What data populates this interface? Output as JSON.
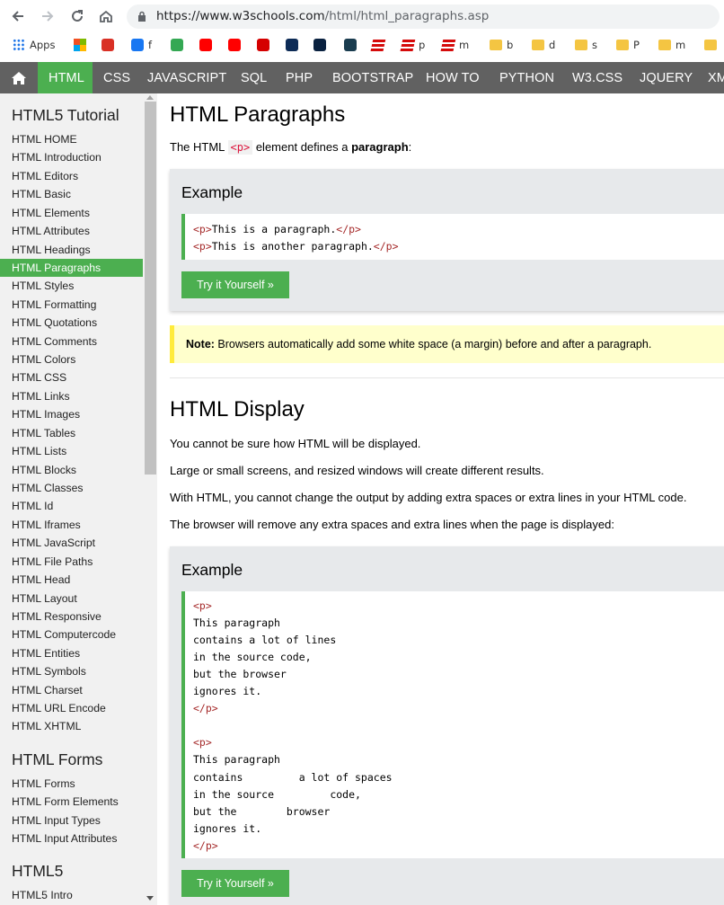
{
  "browser": {
    "url_host": "https://www.w3schools.com",
    "url_path": "/html/html_paragraphs.asp",
    "bookmarks": [
      {
        "label": "Apps",
        "icon": "apps-grid-icon",
        "color": "#1a73e8"
      },
      {
        "label": "",
        "icon": "windows-logo-icon",
        "color": "#f25022"
      },
      {
        "label": "",
        "icon": "gmail-icon",
        "color": "#d93025"
      },
      {
        "label": "f",
        "icon": "facebook-icon",
        "color": "#1877f2"
      },
      {
        "label": "",
        "icon": "google-maps-icon",
        "color": "#34a853"
      },
      {
        "label": "",
        "icon": "youtube-icon",
        "color": "#ff0000"
      },
      {
        "label": "",
        "icon": "youtube-icon",
        "color": "#ff0000"
      },
      {
        "label": "",
        "icon": "tsn-icon",
        "color": "#d50000"
      },
      {
        "label": "",
        "icon": "mlb-icon",
        "color": "#0d2b56"
      },
      {
        "label": "",
        "icon": "pga-tour-icon",
        "color": "#0a2240"
      },
      {
        "label": "",
        "icon": "x-logo-icon",
        "color": "#1a3c4f"
      },
      {
        "label": "",
        "icon": "espn-icon",
        "color": "#d50a0a"
      },
      {
        "label": "p",
        "icon": "espn-icon",
        "color": "#d50a0a"
      },
      {
        "label": "m",
        "icon": "espn-icon",
        "color": "#d50a0a"
      },
      {
        "label": "b",
        "icon": "folder-icon",
        "color": "#f4c542"
      },
      {
        "label": "d",
        "icon": "folder-icon",
        "color": "#f4c542"
      },
      {
        "label": "s",
        "icon": "folder-icon",
        "color": "#f4c542"
      },
      {
        "label": "P",
        "icon": "folder-icon",
        "color": "#f4c542"
      },
      {
        "label": "m",
        "icon": "folder-icon",
        "color": "#f4c542"
      },
      {
        "label": "",
        "icon": "folder-icon",
        "color": "#f4c542"
      }
    ]
  },
  "topnav": {
    "items": [
      "HTML",
      "CSS",
      "JAVASCRIPT",
      "SQL",
      "PHP",
      "BOOTSTRAP",
      "HOW TO",
      "PYTHON",
      "W3.CSS",
      "JQUERY",
      "XM"
    ],
    "active": "HTML"
  },
  "sidebar": {
    "sections": [
      {
        "heading": "HTML5 Tutorial",
        "links": [
          "HTML HOME",
          "HTML Introduction",
          "HTML Editors",
          "HTML Basic",
          "HTML Elements",
          "HTML Attributes",
          "HTML Headings",
          "HTML Paragraphs",
          "HTML Styles",
          "HTML Formatting",
          "HTML Quotations",
          "HTML Comments",
          "HTML Colors",
          "HTML CSS",
          "HTML Links",
          "HTML Images",
          "HTML Tables",
          "HTML Lists",
          "HTML Blocks",
          "HTML Classes",
          "HTML Id",
          "HTML Iframes",
          "HTML JavaScript",
          "HTML File Paths",
          "HTML Head",
          "HTML Layout",
          "HTML Responsive",
          "HTML Computercode",
          "HTML Entities",
          "HTML Symbols",
          "HTML Charset",
          "HTML URL Encode",
          "HTML XHTML"
        ]
      },
      {
        "heading": "HTML Forms",
        "links": [
          "HTML Forms",
          "HTML Form Elements",
          "HTML Input Types",
          "HTML Input Attributes"
        ]
      },
      {
        "heading": "HTML5",
        "links": [
          "HTML5 Intro"
        ]
      }
    ],
    "active_link": "HTML Paragraphs"
  },
  "main": {
    "title": "HTML Paragraphs",
    "intro_before": "The HTML ",
    "intro_code": "<p>",
    "intro_middle": " element defines a ",
    "intro_bold": "paragraph",
    "intro_after": ":",
    "example1": {
      "title": "Example",
      "lines": [
        {
          "open": "<p>",
          "text": "This is a paragraph.",
          "close": "</p>"
        },
        {
          "open": "<p>",
          "text": "This is another paragraph.",
          "close": "</p>"
        }
      ],
      "button": "Try it Yourself »"
    },
    "note": {
      "label": "Note:",
      "text": " Browsers automatically add some white space (a margin) before and after a paragraph."
    },
    "section2_title": "HTML Display",
    "paragraphs": [
      "You cannot be sure how HTML will be displayed.",
      "Large or small screens, and resized windows will create different results.",
      "With HTML, you cannot change the output by adding extra spaces or extra lines in your HTML code.",
      "The browser will remove any extra spaces and extra lines when the page is displayed:"
    ],
    "example2": {
      "title": "Example",
      "lines": [
        "<p>",
        "This paragraph",
        "contains a lot of lines",
        "in the source code,",
        "but the browser",
        "ignores it.",
        "</p>",
        "",
        "<p>",
        "This paragraph",
        "contains         a lot of spaces",
        "in the source         code,",
        "but the        browser",
        "ignores it.",
        "</p>"
      ],
      "button": "Try it Yourself »"
    }
  },
  "colors": {
    "accent": "#4caf50",
    "nav_bg": "#616161",
    "sidebar_bg": "#f1f1f1",
    "example_bg": "#e7e9eb",
    "note_bg": "#ffffcc",
    "note_border": "#ffeb3b"
  }
}
